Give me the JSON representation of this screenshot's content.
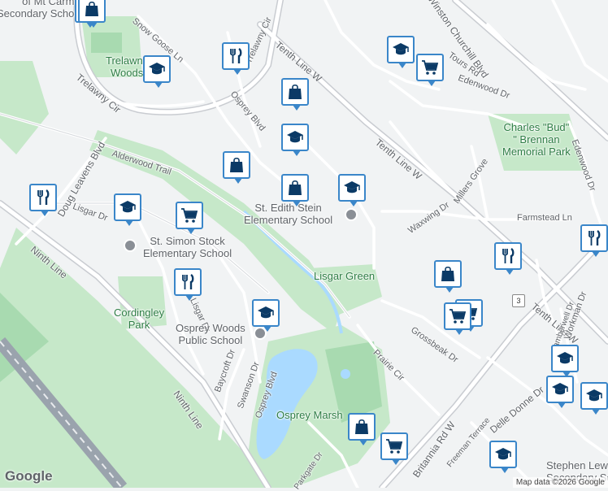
{
  "map": {
    "streets": [
      {
        "id": "snow-goose",
        "text": "Snow Goose Ln"
      },
      {
        "id": "trelawny-cir-top",
        "text": "Trelawny Cir"
      },
      {
        "id": "tenth-line-1",
        "text": "Tenth Line W"
      },
      {
        "id": "winston-churchill",
        "text": "Winston Churchill Blvd"
      },
      {
        "id": "tours-rd",
        "text": "Tours Rd"
      },
      {
        "id": "edenwood-dr-top",
        "text": "Edenwood Dr"
      },
      {
        "id": "osprey-blvd-top",
        "text": "Osprey Blvd"
      },
      {
        "id": "trelawny-cir-left",
        "text": "Trelawny Cir"
      },
      {
        "id": "tenth-line-2",
        "text": "Tenth Line W"
      },
      {
        "id": "millers-grove",
        "text": "Millers Grove"
      },
      {
        "id": "edenwood-dr-right",
        "text": "Edenwood Dr"
      },
      {
        "id": "alderwood-trail",
        "text": "Alderwood Trail"
      },
      {
        "id": "doug-leavens",
        "text": "Doug Leavens Blvd"
      },
      {
        "id": "lisgar-dr",
        "text": "Lisgar Dr"
      },
      {
        "id": "farmstead-ln",
        "text": "Farmstead Ln"
      },
      {
        "id": "waxwing-dr",
        "text": "Waxwing Dr"
      },
      {
        "id": "ninth-line-1",
        "text": "Ninth Line"
      },
      {
        "id": "lisgar-dr-2",
        "text": "Lisgar Dr"
      },
      {
        "id": "tenth-line-3",
        "text": "Tenth Line W"
      },
      {
        "id": "workman-dr",
        "text": "Workman Dr"
      },
      {
        "id": "camberwell-dr",
        "text": "Camberwell Dr"
      },
      {
        "id": "grossbeak-dr",
        "text": "Grossbeak Dr"
      },
      {
        "id": "prairie-cir",
        "text": "Prairie Cir"
      },
      {
        "id": "baycroft-dr",
        "text": "Baycroft Dr"
      },
      {
        "id": "swanson-dr",
        "text": "Swanson Dr"
      },
      {
        "id": "osprey-blvd-bottom",
        "text": "Osprey Blvd"
      },
      {
        "id": "ninth-line-2",
        "text": "Ninth Line"
      },
      {
        "id": "britannia-rd",
        "text": "Britannia Rd W"
      },
      {
        "id": "delle-donne",
        "text": "Delle Donne Dr"
      },
      {
        "id": "freeman-terrace",
        "text": "Freeman Terrace"
      },
      {
        "id": "parkgate-dr",
        "text": "Parkgate Dr"
      },
      {
        "id": "lo-partial",
        "text": "Lo"
      }
    ],
    "places": [
      {
        "id": "mt-carmel",
        "text": "of Mt Carmel\nSecondary School"
      },
      {
        "id": "st-edith-stein",
        "text": "St. Edith Stein\nElementary School"
      },
      {
        "id": "st-simon-stock",
        "text": "St. Simon Stock\nElementary School"
      },
      {
        "id": "osprey-woods",
        "text": "Osprey Woods\nPublic School"
      },
      {
        "id": "stephen-lewis",
        "text": "Stephen Lew\nSecondary Scho"
      }
    ],
    "parks": [
      {
        "id": "trelawny-woods",
        "text": "Trelawny\nWoods"
      },
      {
        "id": "charles-brennan",
        "text": "Charles \"Bud\"\n\" Brennan\nMemorial Park"
      },
      {
        "id": "lisgar-green",
        "text": "Lisgar Green"
      },
      {
        "id": "cordingley-park",
        "text": "Cordingley\nPark"
      },
      {
        "id": "osprey-marsh",
        "text": "Osprey Marsh"
      }
    ],
    "route_shield": "3",
    "markers": [
      {
        "id": "school-1",
        "icon": "school-icon"
      },
      {
        "id": "shop-1",
        "icon": "shopping-bag-icon"
      },
      {
        "id": "school-2",
        "icon": "school-icon"
      },
      {
        "id": "restaurant-1",
        "icon": "restaurant-icon"
      },
      {
        "id": "school-3",
        "icon": "school-icon"
      },
      {
        "id": "grocery-1",
        "icon": "shopping-cart-icon"
      },
      {
        "id": "shop-2",
        "icon": "shopping-bag-icon"
      },
      {
        "id": "school-4",
        "icon": "school-icon"
      },
      {
        "id": "shop-3",
        "icon": "shopping-bag-icon"
      },
      {
        "id": "shop-4",
        "icon": "shopping-bag-icon"
      },
      {
        "id": "school-5",
        "icon": "school-icon"
      },
      {
        "id": "restaurant-2",
        "icon": "restaurant-icon"
      },
      {
        "id": "school-6",
        "icon": "school-icon"
      },
      {
        "id": "grocery-2",
        "icon": "shopping-cart-icon"
      },
      {
        "id": "restaurant-3",
        "icon": "restaurant-icon"
      },
      {
        "id": "shop-5",
        "icon": "shopping-bag-icon"
      },
      {
        "id": "restaurant-4",
        "icon": "restaurant-icon"
      },
      {
        "id": "grocery-3",
        "icon": "shopping-cart-icon"
      },
      {
        "id": "grocery-4",
        "icon": "shopping-cart-icon"
      },
      {
        "id": "school-7",
        "icon": "school-icon"
      },
      {
        "id": "school-8",
        "icon": "school-icon"
      },
      {
        "id": "school-9",
        "icon": "school-icon"
      },
      {
        "id": "school-10",
        "icon": "school-icon"
      },
      {
        "id": "shop-6",
        "icon": "shopping-bag-icon"
      },
      {
        "id": "grocery-5",
        "icon": "shopping-cart-icon"
      },
      {
        "id": "school-11",
        "icon": "school-icon"
      },
      {
        "id": "restaurant-5",
        "icon": "restaurant-icon"
      }
    ],
    "colors": {
      "land": "#f1f3f4",
      "road": "#ffffff",
      "road_outline": "#d5d8dc",
      "arterial": "#c9ccd1",
      "park": "#c6e8c9",
      "park_dark": "#a8dab0",
      "water": "#aadaff",
      "marker_border": "#3a86c9",
      "marker_icon": "#0b3a66",
      "highway": "#9aa3ad"
    }
  },
  "logo": "Google",
  "attribution": "Map data ©2026 Google"
}
